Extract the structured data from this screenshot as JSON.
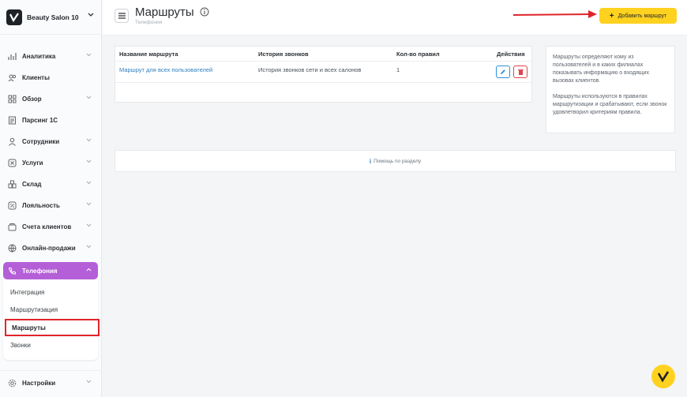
{
  "brand": {
    "name": "Beauty Salon 10"
  },
  "header": {
    "title": "Маршруты",
    "breadcrumb": "Телефония",
    "add_button": "Добавить маршрут"
  },
  "sidebar": {
    "items": [
      {
        "label": "Аналитика",
        "icon": "analytics-icon"
      },
      {
        "label": "Клиенты",
        "icon": "clients-icon"
      },
      {
        "label": "Обзор",
        "icon": "overview-icon"
      },
      {
        "label": "Парсинг 1С",
        "icon": "parsing-icon"
      },
      {
        "label": "Сотрудники",
        "icon": "staff-icon"
      },
      {
        "label": "Услуги",
        "icon": "services-icon"
      },
      {
        "label": "Склад",
        "icon": "warehouse-icon"
      },
      {
        "label": "Лояльность",
        "icon": "loyalty-icon"
      },
      {
        "label": "Счета клиентов",
        "icon": "accounts-icon"
      },
      {
        "label": "Онлайн-продажи",
        "icon": "online-sales-icon"
      },
      {
        "label": "Телефония",
        "icon": "phone-icon"
      }
    ],
    "submenu": [
      {
        "label": "Интеграция"
      },
      {
        "label": "Маршрутизация"
      },
      {
        "label": "Маршруты"
      },
      {
        "label": "Звонки"
      }
    ],
    "settings": "Настройки"
  },
  "table": {
    "columns": [
      "Название маршрута",
      "История звонков",
      "Кол-во правил",
      "Действия"
    ],
    "rows": [
      {
        "name": "Маршрут для всех пользователей",
        "history": "История звонков сети и всех салонов",
        "rules": "1"
      }
    ]
  },
  "info": {
    "p1": "Маршруты определяют кому из пользователей и в каких филиалах показывать информацию о входящих вызовах клиентов.",
    "p2": "Маршруты используются в правилах маршрутизации и срабатывают, если звонок удовлетворил критериям правила."
  },
  "help": {
    "label": "Помощь по разделу"
  },
  "colors": {
    "accent": "#ffd21f",
    "telephony": "#b45fd8",
    "highlight": "#e0242b",
    "link": "#2f7fc1"
  }
}
